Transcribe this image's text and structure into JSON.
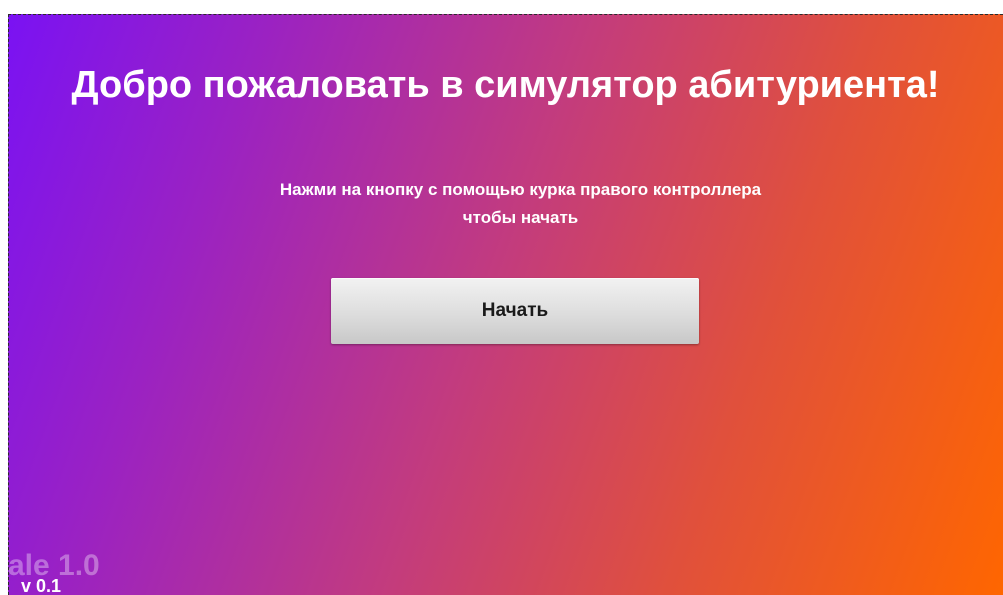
{
  "welcome": {
    "title": "Добро пожаловать в симулятор абитуриента!",
    "instruction_line1": "Нажми на кнопку с помощью курка правого контроллера",
    "instruction_line2": "чтобы начать"
  },
  "start_button": {
    "label": "Начать"
  },
  "footer": {
    "watermark": "ale 1.0",
    "version": "v 0.1"
  },
  "colors": {
    "gradient_start": "#7a12f3",
    "gradient_end": "#ff6600",
    "text": "#ffffff",
    "button": "#e0e0e0"
  }
}
